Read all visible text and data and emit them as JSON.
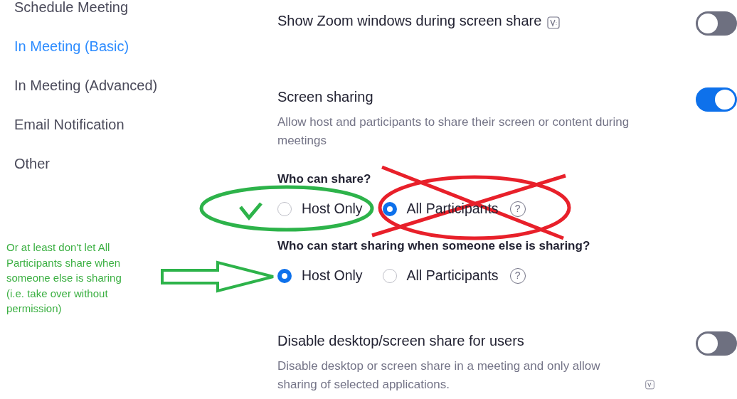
{
  "sidebar": {
    "items": [
      {
        "label": "Schedule Meeting",
        "selected": false
      },
      {
        "label": "In Meeting (Basic)",
        "selected": true
      },
      {
        "label": "In Meeting (Advanced)",
        "selected": false
      },
      {
        "label": "Email Notification",
        "selected": false
      },
      {
        "label": "Other",
        "selected": false
      }
    ]
  },
  "settings": [
    {
      "title": "Show Zoom windows during screen share",
      "badge": true,
      "on": false
    },
    {
      "title": "Screen sharing",
      "description": "Allow host and participants to share their screen or content during meetings",
      "on": true,
      "groups": [
        {
          "question": "Who can share?",
          "options": [
            {
              "label": "Host Only",
              "selected": false
            },
            {
              "label": "All Participants",
              "selected": true,
              "help": "?"
            }
          ]
        },
        {
          "question": "Who can start sharing when someone else is sharing?",
          "options": [
            {
              "label": "Host Only",
              "selected": true
            },
            {
              "label": "All Participants",
              "selected": false,
              "help": "?"
            }
          ]
        }
      ]
    },
    {
      "title": "Disable desktop/screen share for users",
      "description": "Disable desktop or screen share in a meeting and only allow sharing of selected applications.",
      "desc_badge": true,
      "on": false
    }
  ],
  "annotation": {
    "note": "Or at least don't let All Participants share when someone else is sharing (i.e. take over without permission)"
  }
}
